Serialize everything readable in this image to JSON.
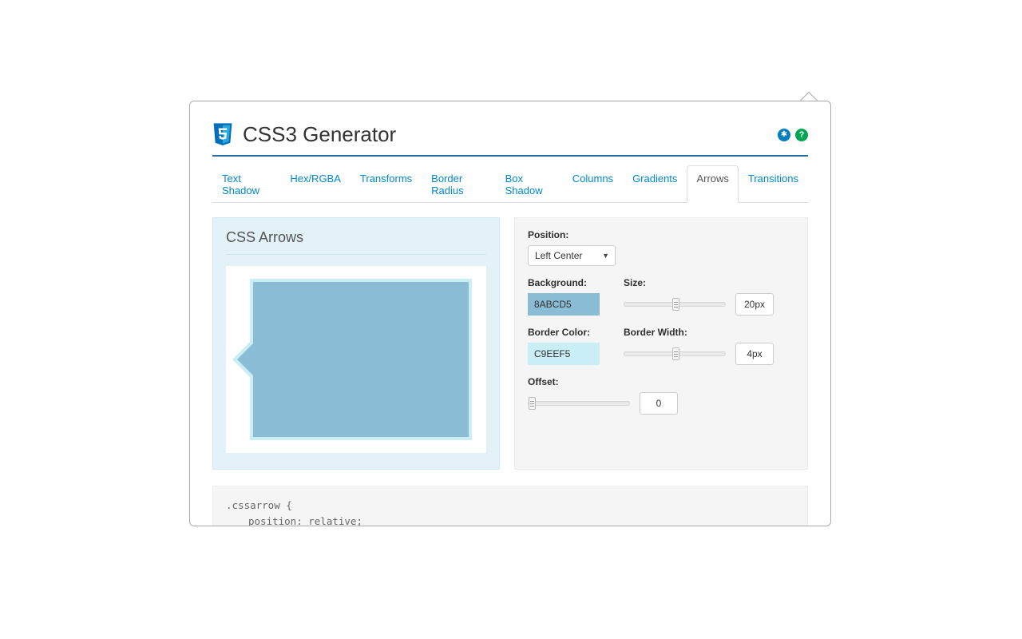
{
  "header": {
    "title": "CSS3 Generator",
    "settings_icon": "gear",
    "help_icon": "?"
  },
  "tabs": [
    {
      "label": "Text Shadow",
      "active": false
    },
    {
      "label": "Hex/RGBA",
      "active": false
    },
    {
      "label": "Transforms",
      "active": false
    },
    {
      "label": "Border Radius",
      "active": false
    },
    {
      "label": "Box Shadow",
      "active": false
    },
    {
      "label": "Columns",
      "active": false
    },
    {
      "label": "Gradients",
      "active": false
    },
    {
      "label": "Arrows",
      "active": true
    },
    {
      "label": "Transitions",
      "active": false
    }
  ],
  "preview": {
    "title": "CSS Arrows",
    "background_color": "8ABCD5",
    "border_color": "C9EEF5"
  },
  "controls": {
    "position": {
      "label": "Position:",
      "value": "Left Center"
    },
    "background": {
      "label": "Background:",
      "value": "8ABCD5"
    },
    "size": {
      "label": "Size:",
      "value": "20px",
      "slider_pct": 48
    },
    "border_color": {
      "label": "Border Color:",
      "value": "C9EEF5"
    },
    "border_width": {
      "label": "Border Width:",
      "value": "4px",
      "slider_pct": 48
    },
    "offset": {
      "label": "Offset:",
      "value": "0",
      "slider_pct": 0
    }
  },
  "code": {
    "line1": ".cssarrow {",
    "line2": "position: relative;"
  }
}
